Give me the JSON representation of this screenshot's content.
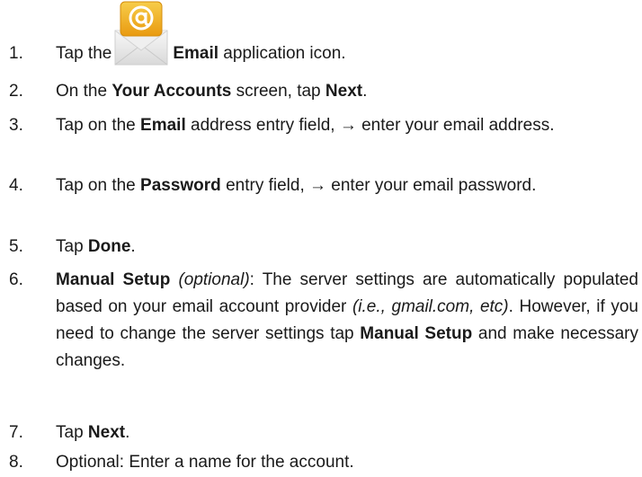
{
  "steps": [
    {
      "number": "1.",
      "text_1": "Tap the",
      "icon": "email-app-icon",
      "bold_1": "Email",
      "text_2": " application icon."
    },
    {
      "number": "2.",
      "text_1": "On the ",
      "bold_1": "Your Accounts",
      "text_2": " screen, tap ",
      "bold_2": "Next",
      "text_3": "."
    },
    {
      "number": "3.",
      "text_1": "Tap on the ",
      "bold_1": "Email",
      "text_2": " address entry field, → enter your email address."
    },
    {
      "number": "4.",
      "text_1": "Tap on the ",
      "bold_1": "Password",
      "text_2": " entry field, → enter your email password."
    },
    {
      "number": "5.",
      "text_1": "Tap ",
      "bold_1": "Done",
      "text_2": "."
    },
    {
      "number": "6.",
      "bold_1": "Manual Setup",
      "italic_1": "(optional)",
      "text_1": ": The server settings are automatically populated based on your email account provider ",
      "italic_2": "(i.e., gmail.com, etc)",
      "text_2": ". However, if you need to change the server settings tap ",
      "bold_2": "Manual Setup",
      "text_3": " and make necessary changes."
    },
    {
      "number": "7.",
      "text_1": "Tap ",
      "bold_1": "Next",
      "text_2": "."
    },
    {
      "number": "8.",
      "text_1": "Optional: Enter a name for the account."
    }
  ],
  "colors": {
    "text": "#1a1a1a",
    "icon_envelope": "#ececec",
    "icon_badge": "#f2b21c"
  }
}
